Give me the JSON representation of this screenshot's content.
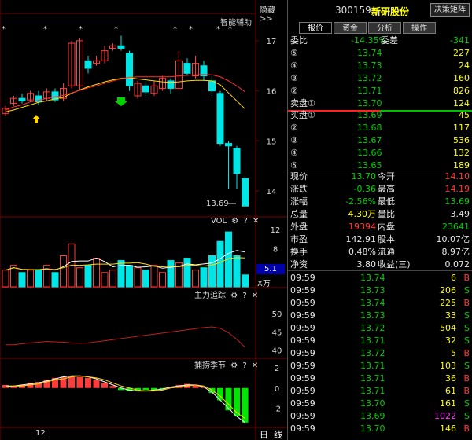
{
  "header": {
    "hide_label": "隐藏>>",
    "stock_code": "300159",
    "stock_name": "新研股份",
    "button_label": "决策矩阵"
  },
  "tabs": [
    {
      "label": "报价",
      "active": true
    },
    {
      "label": "资金",
      "active": false
    },
    {
      "label": "分析",
      "active": false
    },
    {
      "label": "操作",
      "active": false
    }
  ],
  "commission": {
    "ratio_label": "委比",
    "ratio_value": "-14.35%",
    "diff_label": "委差",
    "diff_value": "-341"
  },
  "sell_orders": [
    {
      "label": "⑤",
      "price": "13.74",
      "volume": "227"
    },
    {
      "label": "④",
      "price": "13.73",
      "volume": "24"
    },
    {
      "label": "③",
      "price": "13.72",
      "volume": "160"
    },
    {
      "label": "②",
      "price": "13.71",
      "volume": "826"
    },
    {
      "label": "卖盘①",
      "price": "13.70",
      "volume": "124"
    }
  ],
  "buy_orders": [
    {
      "label": "买盘①",
      "price": "13.69",
      "volume": "45"
    },
    {
      "label": "②",
      "price": "13.68",
      "volume": "117"
    },
    {
      "label": "③",
      "price": "13.67",
      "volume": "536"
    },
    {
      "label": "④",
      "price": "13.66",
      "volume": "132"
    },
    {
      "label": "⑤",
      "price": "13.65",
      "volume": "189"
    }
  ],
  "stats": [
    {
      "l1": "现价",
      "v1": "13.70",
      "c1": "green",
      "l2": "今开",
      "v2": "14.10",
      "c2": "red"
    },
    {
      "l1": "涨跌",
      "v1": "-0.36",
      "c1": "green",
      "l2": "最高",
      "v2": "14.19",
      "c2": "red"
    },
    {
      "l1": "涨幅",
      "v1": "-2.56%",
      "c1": "green",
      "l2": "最低",
      "v2": "13.69",
      "c2": "green"
    },
    {
      "l1": "总量",
      "v1": "4.30万",
      "c1": "yellow",
      "l2": "量比",
      "v2": "3.49",
      "c2": "white"
    },
    {
      "l1": "外盘",
      "v1": "19394",
      "c1": "red",
      "l2": "内盘",
      "v2": "23641",
      "c2": "green"
    },
    {
      "l1": "市盈",
      "v1": "142.91",
      "c1": "white",
      "l2": "股本",
      "v2": "10.07亿",
      "c2": "white"
    },
    {
      "l1": "换手",
      "v1": "0.48%",
      "c1": "white",
      "l2": "流通",
      "v2": "8.97亿",
      "c2": "white"
    },
    {
      "l1": "净资",
      "v1": "3.80",
      "c1": "white",
      "l2": "收益(三)",
      "v2": "0.072",
      "c2": "white"
    }
  ],
  "trades": [
    {
      "time": "09:59",
      "price": "13.74",
      "vol": "6",
      "side": "B",
      "vc": "yellow"
    },
    {
      "time": "09:59",
      "price": "13.73",
      "vol": "206",
      "side": "S",
      "vc": "yellow"
    },
    {
      "time": "09:59",
      "price": "13.74",
      "vol": "225",
      "side": "B",
      "vc": "yellow"
    },
    {
      "time": "09:59",
      "price": "13.73",
      "vol": "33",
      "side": "S",
      "vc": "yellow"
    },
    {
      "time": "09:59",
      "price": "13.72",
      "vol": "504",
      "side": "S",
      "vc": "yellow"
    },
    {
      "time": "09:59",
      "price": "13.71",
      "vol": "32",
      "side": "S",
      "vc": "yellow"
    },
    {
      "time": "09:59",
      "price": "13.72",
      "vol": "5",
      "side": "B",
      "vc": "yellow"
    },
    {
      "time": "09:59",
      "price": "13.71",
      "vol": "103",
      "side": "S",
      "vc": "yellow"
    },
    {
      "time": "09:59",
      "price": "13.71",
      "vol": "36",
      "side": "B",
      "vc": "yellow"
    },
    {
      "time": "09:59",
      "price": "13.71",
      "vol": "61",
      "side": "B",
      "vc": "yellow"
    },
    {
      "time": "09:59",
      "price": "13.70",
      "vol": "161",
      "side": "S",
      "vc": "yellow"
    },
    {
      "time": "09:59",
      "price": "13.69",
      "vol": "1022",
      "side": "S",
      "vc": "magenta"
    },
    {
      "time": "09:59",
      "price": "13.70",
      "vol": "146",
      "side": "B",
      "vc": "yellow"
    }
  ],
  "chart": {
    "assist_label": "智能辅助",
    "price_ticks": [
      "17",
      "16",
      "15",
      "14"
    ],
    "last_price_label": "13.69",
    "vol_label": "VOL",
    "vol_ticks": [
      "12",
      "8"
    ],
    "vol_scale_value": "5.1",
    "vol_unit": "X万",
    "trace_label": "主力追踪",
    "trace_ticks": [
      "50",
      "45",
      "40"
    ],
    "swing_label": "捕捞季节",
    "swing_ticks": [
      "2",
      "0",
      "-2"
    ],
    "date_label": "12",
    "period_day": "日",
    "period_line": "线",
    "ctrl_gear": "⚙",
    "ctrl_help": "?",
    "ctrl_close": "✕",
    "star": "*"
  },
  "chart_data": {
    "type": "candlestick",
    "price_range": [
      13.5,
      17.5
    ],
    "candles": [
      {
        "o": 15.55,
        "c": 15.65,
        "h": 15.7,
        "l": 15.5
      },
      {
        "o": 15.75,
        "c": 15.85,
        "h": 15.9,
        "l": 15.7
      },
      {
        "o": 15.85,
        "c": 15.8,
        "h": 15.95,
        "l": 15.75
      },
      {
        "o": 15.82,
        "c": 15.95,
        "h": 16.0,
        "l": 15.78
      },
      {
        "o": 15.9,
        "c": 15.78,
        "h": 16.0,
        "l": 15.72
      },
      {
        "o": 15.85,
        "c": 15.98,
        "h": 16.05,
        "l": 15.8
      },
      {
        "o": 15.98,
        "c": 15.82,
        "h": 16.05,
        "l": 15.78
      },
      {
        "o": 15.85,
        "c": 16.05,
        "h": 16.15,
        "l": 15.8
      },
      {
        "o": 16.1,
        "c": 16.95,
        "h": 17.0,
        "l": 16.05
      },
      {
        "o": 16.1,
        "c": 17.0,
        "h": 17.05,
        "l": 16.0
      },
      {
        "o": 16.6,
        "c": 16.45,
        "h": 16.7,
        "l": 16.35
      },
      {
        "o": 16.55,
        "c": 16.6,
        "h": 16.7,
        "l": 16.5
      },
      {
        "o": 16.6,
        "c": 16.8,
        "h": 16.9,
        "l": 16.55
      },
      {
        "o": 16.85,
        "c": 16.9,
        "h": 16.95,
        "l": 16.8
      },
      {
        "o": 16.9,
        "c": 16.85,
        "h": 17.1,
        "l": 16.8
      },
      {
        "o": 16.75,
        "c": 16.1,
        "h": 16.8,
        "l": 16.0
      },
      {
        "o": 15.9,
        "c": 16.15,
        "h": 16.2,
        "l": 15.85
      },
      {
        "o": 16.1,
        "c": 15.98,
        "h": 16.2,
        "l": 15.9
      },
      {
        "o": 15.95,
        "c": 16.1,
        "h": 16.2,
        "l": 15.9
      },
      {
        "o": 16.05,
        "c": 16.25,
        "h": 16.3,
        "l": 16.0
      },
      {
        "o": 16.2,
        "c": 16.05,
        "h": 16.25,
        "l": 15.95
      },
      {
        "o": 16.05,
        "c": 16.6,
        "h": 16.8,
        "l": 16.0
      },
      {
        "o": 16.55,
        "c": 16.35,
        "h": 16.65,
        "l": 16.3
      },
      {
        "o": 16.3,
        "c": 16.55,
        "h": 16.7,
        "l": 16.25
      },
      {
        "o": 16.5,
        "c": 16.3,
        "h": 16.6,
        "l": 16.2
      },
      {
        "o": 16.2,
        "c": 16.0,
        "h": 16.3,
        "l": 15.9
      },
      {
        "o": 15.95,
        "c": 14.95,
        "h": 16.0,
        "l": 14.9
      },
      {
        "o": 14.95,
        "c": 14.9,
        "h": 15.0,
        "l": 14.05
      },
      {
        "o": 14.85,
        "c": 14.35,
        "h": 14.9,
        "l": 14.05
      },
      {
        "o": 14.25,
        "c": 13.7,
        "h": 14.3,
        "l": 13.69
      }
    ],
    "ma_yellow": [
      15.58,
      15.62,
      15.67,
      15.72,
      15.77,
      15.8,
      15.84,
      15.87,
      15.95,
      16.02,
      16.08,
      16.13,
      16.18,
      16.22,
      16.25,
      16.26,
      16.24,
      16.22,
      16.2,
      16.18,
      16.17,
      16.18,
      16.2,
      16.21,
      16.21,
      16.2,
      16.12,
      15.96,
      15.8,
      15.64
    ],
    "ma_red": [
      15.62,
      15.68,
      15.72,
      15.78,
      15.81,
      15.85,
      15.88,
      15.91,
      15.96,
      16.01,
      16.06,
      16.1,
      16.15,
      16.2,
      16.24,
      16.27,
      16.28,
      16.28,
      16.28,
      16.28,
      16.28,
      16.3,
      16.31,
      16.32,
      16.33,
      16.32,
      16.28,
      16.2,
      16.1,
      15.98
    ],
    "volumes": [
      3.5,
      4.5,
      3.0,
      3.5,
      3.5,
      4.5,
      3.0,
      6.5,
      9.0,
      4.0,
      4.5,
      6.0,
      3.0,
      3.5,
      5.5,
      4.5,
      4.0,
      3.5,
      4.5,
      3.0,
      5.5,
      5.0,
      6.0,
      3.5,
      4.0,
      6.5,
      9.5,
      11.5,
      6.5,
      2.5
    ],
    "volume_up": [
      true,
      true,
      false,
      true,
      false,
      true,
      false,
      true,
      true,
      true,
      false,
      true,
      true,
      true,
      false,
      false,
      true,
      false,
      true,
      true,
      false,
      true,
      false,
      true,
      false,
      false,
      false,
      false,
      false,
      false
    ],
    "vol_range": [
      0,
      13
    ],
    "trace_line": [
      41.5,
      41.5,
      41.8,
      42.0,
      42.2,
      42.4,
      42.3,
      42.2,
      42.0,
      41.9,
      42.0,
      42.3,
      42.6,
      42.9,
      43.2,
      43.5,
      43.8,
      44.1,
      44.4,
      44.7,
      45.0,
      45.3,
      45.6,
      45.9,
      46.2,
      46.4,
      46.0,
      44.8,
      43.0,
      40.8
    ],
    "trace_range": [
      38,
      55
    ],
    "swing_bars": [
      0.3,
      0.2,
      0.3,
      0.5,
      0.6,
      0.8,
      1.0,
      1.1,
      1.2,
      1.1,
      1.0,
      0.8,
      0.5,
      0.2,
      -0.2,
      -0.3,
      -0.3,
      -0.2,
      -0.2,
      -0.1,
      0.1,
      0.3,
      0.4,
      0.3,
      0.1,
      -0.5,
      -1.2,
      -2.2,
      -2.8,
      -3.4
    ],
    "swing_line1": [
      0.2,
      0.2,
      0.3,
      0.4,
      0.5,
      0.7,
      0.9,
      1.1,
      1.2,
      1.2,
      1.1,
      0.9,
      0.6,
      0.3,
      0.0,
      -0.2,
      -0.3,
      -0.3,
      -0.2,
      -0.1,
      0.1,
      0.2,
      0.3,
      0.3,
      0.1,
      -0.4,
      -1.2,
      -2.0,
      -2.8,
      -3.4
    ],
    "swing_line2": [
      0.1,
      0.2,
      0.2,
      0.3,
      0.4,
      0.6,
      0.8,
      0.9,
      1.1,
      1.2,
      1.1,
      1.0,
      0.8,
      0.5,
      0.2,
      0.0,
      -0.2,
      -0.3,
      -0.3,
      -0.2,
      0.0,
      0.1,
      0.2,
      0.3,
      0.2,
      -0.2,
      -0.8,
      -1.6,
      -2.4,
      -3.0
    ],
    "swing_range": [
      -3.8,
      2.3
    ]
  },
  "colors": {
    "up": "#ff3c3c",
    "down": "#00e6e6",
    "ma_yellow": "#ffd800",
    "ma_red": "#ff3030",
    "grid_red": "#7a0000"
  }
}
